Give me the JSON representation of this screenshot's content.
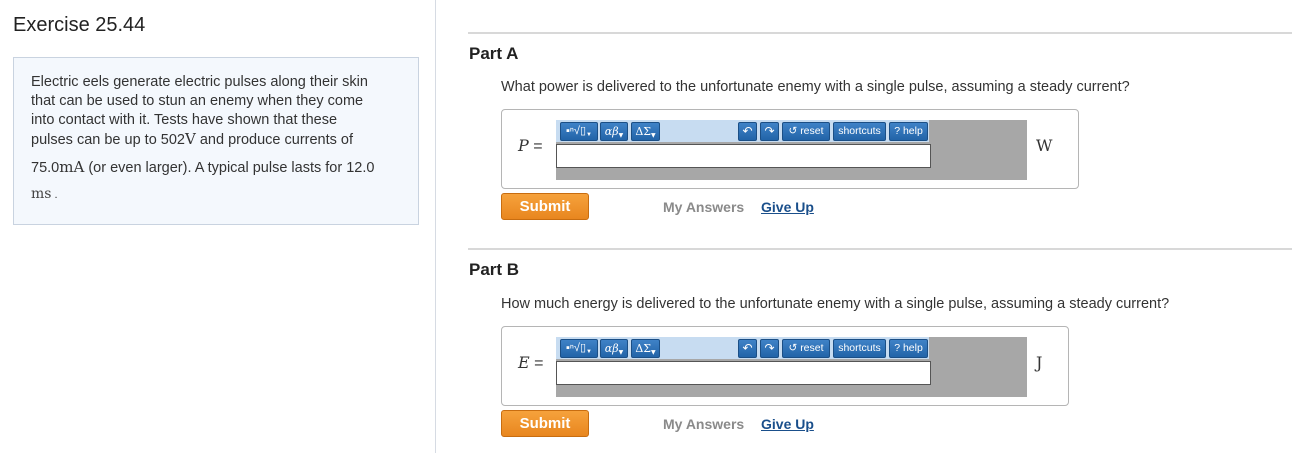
{
  "exercise": {
    "title": "Exercise 25.44"
  },
  "problem": {
    "lines": [
      "Electric eels generate electric pulses along their skin",
      "that can be used to stun an enemy when they come",
      "into contact with it. Tests have shown that these"
    ],
    "line4_pre": "pulses can be up to ",
    "voltage_value": "502",
    "voltage_unit": "V",
    "line4_post": " and produce currents of",
    "current_value": "75.0",
    "current_unit": "mA",
    "line5_post": " (or even larger). A typical pulse lasts for 12.0",
    "time_unit": "ms",
    "time_post": " ."
  },
  "toolbar": {
    "template_btn": "▪ⁿ√▯",
    "greek_btn": "αβ",
    "symbol_btn": "ΔΣ",
    "undo_icon": "undo-icon",
    "redo_icon": "redo-icon",
    "reset_label": "reset",
    "shortcuts_label": "shortcuts",
    "help_label": "help",
    "dropdown_glyph": "▼"
  },
  "parts": [
    {
      "title": "Part A",
      "question": "What power is delivered to the unfortunate enemy with a single pulse, assuming a steady current?",
      "variable": "P",
      "equals": " =",
      "answer_value": "",
      "unit": "W",
      "submit_label": "Submit",
      "my_answers_label": "My Answers",
      "give_up_label": "Give Up"
    },
    {
      "title": "Part B",
      "question": "How much energy is delivered to the unfortunate enemy with a single pulse, assuming a steady current?",
      "variable": "E",
      "equals": " =",
      "answer_value": "",
      "unit": "J",
      "submit_label": "Submit",
      "my_answers_label": "My Answers",
      "give_up_label": "Give Up"
    }
  ],
  "colors": {
    "submit": "#f0962e",
    "toolbar_bg": "#c7dcf1",
    "toolbar_btn": "#2f73b8",
    "editor_bg": "#a7a7a7",
    "link": "#1a4f8b"
  }
}
